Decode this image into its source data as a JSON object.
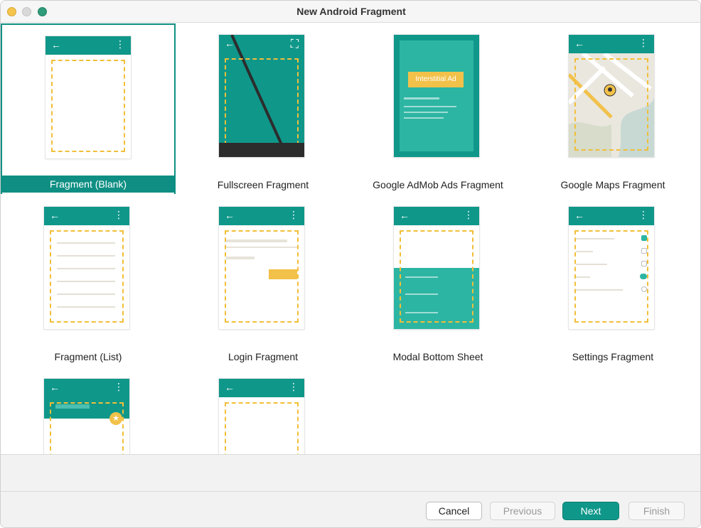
{
  "window": {
    "title": "New Android Fragment"
  },
  "templates": [
    {
      "label": "Fragment (Blank)",
      "selected": true
    },
    {
      "label": "Fullscreen Fragment"
    },
    {
      "label": "Google AdMob Ads Fragment",
      "preview_text": "Interstitial Ad"
    },
    {
      "label": "Google Maps Fragment"
    },
    {
      "label": "Fragment (List)"
    },
    {
      "label": "Login Fragment"
    },
    {
      "label": "Modal Bottom Sheet"
    },
    {
      "label": "Settings Fragment"
    },
    {
      "label": ""
    },
    {
      "label": ""
    }
  ],
  "buttons": {
    "cancel": "Cancel",
    "previous": "Previous",
    "next": "Next",
    "finish": "Finish"
  },
  "colors": {
    "accent": "#0f978a",
    "selected_label_bg": "#0f8f83",
    "dashed_outline": "#f1bf39"
  }
}
